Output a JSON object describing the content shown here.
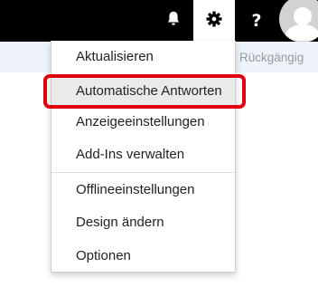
{
  "header": {
    "buttons": [
      {
        "name": "notifications",
        "icon": "bell-icon"
      },
      {
        "name": "settings",
        "icon": "gear-icon"
      },
      {
        "name": "help",
        "icon": "question-icon",
        "glyph": "?"
      },
      {
        "name": "account",
        "icon": "avatar-icon"
      }
    ]
  },
  "command_bar": {
    "undo_label": "Rückgängig"
  },
  "settings_menu": {
    "items": [
      {
        "label": "Aktualisieren"
      },
      {
        "label": "Automatische Antworten",
        "highlighted": true
      },
      {
        "label": "Anzeigeeinstellungen"
      },
      {
        "label": "Add-Ins verwalten"
      },
      {
        "label": "Offlineeinstellungen"
      },
      {
        "label": "Design ändern"
      },
      {
        "label": "Optionen"
      }
    ]
  },
  "colors": {
    "topbar": "#000000",
    "highlight_border": "#e0000f",
    "command_bar": "#eef3fb"
  }
}
